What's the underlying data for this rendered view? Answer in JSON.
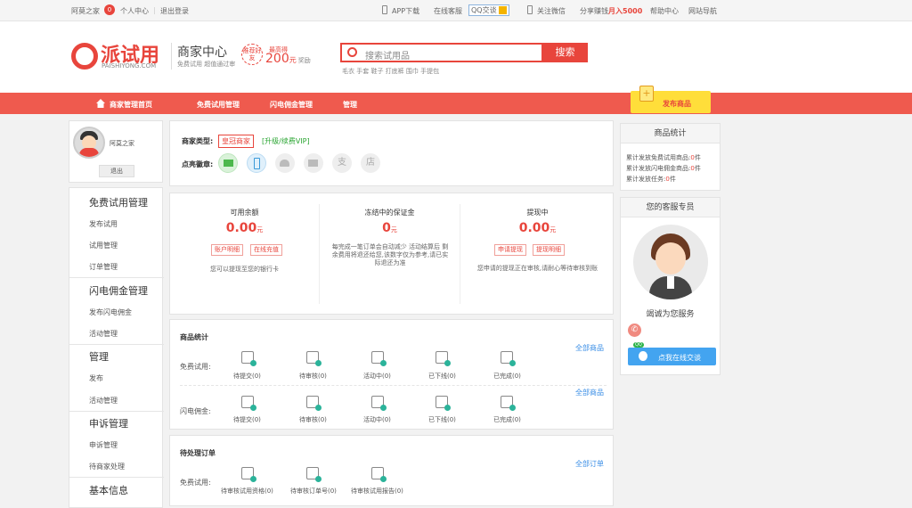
{
  "topbar": {
    "site": "阿莫之家",
    "badge": "0",
    "personal": "个人中心",
    "logout": "退出登录",
    "app": "APP下载",
    "online_service": "在线客服",
    "qq": "QQ交谈",
    "wechat": "关注微信",
    "share": "分享赚钱",
    "month": "月入5000",
    "help": "帮助中心",
    "sitemap": "网站导航"
  },
  "logo": {
    "name": "派试用",
    "domain": "PAISHIYONG.COM",
    "center_title": "商家中心",
    "center_sub": "免费试用 超值通过审",
    "recommend": "推荐好友",
    "max_label": "最高得",
    "amount": "200",
    "unit": "元",
    "reward": "奖励"
  },
  "search": {
    "placeholder": "搜索试用品",
    "button": "搜索",
    "hot": "毛衣 手套 鞋子 打底裤 围巾 手提包"
  },
  "nav": {
    "home": "商家管理首页",
    "free": "免费试用管理",
    "flash": "闪电佣金管理",
    "manage": "管理",
    "publish": "发布商品"
  },
  "sidebar": {
    "user": "阿莫之家",
    "logout": "退出",
    "sec1": "免费试用管理",
    "sec1_items": [
      "发布试用",
      "试用管理",
      "订单管理"
    ],
    "sec2": "闪电佣金管理",
    "sec2_items": [
      "发布闪电佣金",
      "活动管理"
    ],
    "sec3": "管理",
    "sec3_items": [
      "发布",
      "活动管理"
    ],
    "sec4": "申诉管理",
    "sec4_items": [
      "申诉管理",
      "待商家处理"
    ],
    "sec5": "基本信息"
  },
  "merchant": {
    "type_label": "商家类型:",
    "type_value": "皇冠商家",
    "upgrade": "[升级/续费VIP]",
    "badges_label": "点亮徽章:",
    "badge_texts": [
      "支",
      "店"
    ]
  },
  "funds": [
    {
      "title": "可用余额",
      "amount": "0.00",
      "unit": "元",
      "tags": [
        "账户明细",
        "在线充值"
      ],
      "note": "您可以提现至您的银行卡"
    },
    {
      "title": "冻结中的保证金",
      "amount": "0",
      "unit": "元",
      "tags": [],
      "note": "每完成一笔订单会自动减少 活动结算后 剩余费用将退还给您,该数字仅为参考,请已实际退还为准"
    },
    {
      "title": "提现中",
      "amount": "0.00",
      "unit": "元",
      "tags": [
        "申请提现",
        "提现明细"
      ],
      "note": "您申请的提现正在审核,请耐心等待审核到账"
    }
  ],
  "goods_stats": {
    "title": "商品统计",
    "all": "全部商品",
    "row1_label": "免费试用:",
    "row2_label": "闪电佣金:",
    "labels": [
      "待提交(0)",
      "待审核(0)",
      "活动中(0)",
      "已下线(0)",
      "已完成(0)"
    ]
  },
  "orders": {
    "title": "待处理订单",
    "all": "全部订单",
    "row_label": "免费试用:",
    "labels": [
      "待审核试用资格(0)",
      "待审核订单号(0)",
      "待审核试用报告(0)"
    ]
  },
  "right": {
    "stats_title": "商品统计",
    "lines": [
      {
        "text": "累计发放免费试用商品:",
        "num": "0",
        "unit": "件"
      },
      {
        "text": "累计发放闪电佣金商品:",
        "num": "0",
        "unit": "件"
      },
      {
        "text": "累计发放任务:",
        "num": "0",
        "unit": "件"
      }
    ],
    "service_title": "您的客服专员",
    "service_name": "竭诚为您服务",
    "chat": "点我在线交谈",
    "qq_badge": "QQ"
  }
}
